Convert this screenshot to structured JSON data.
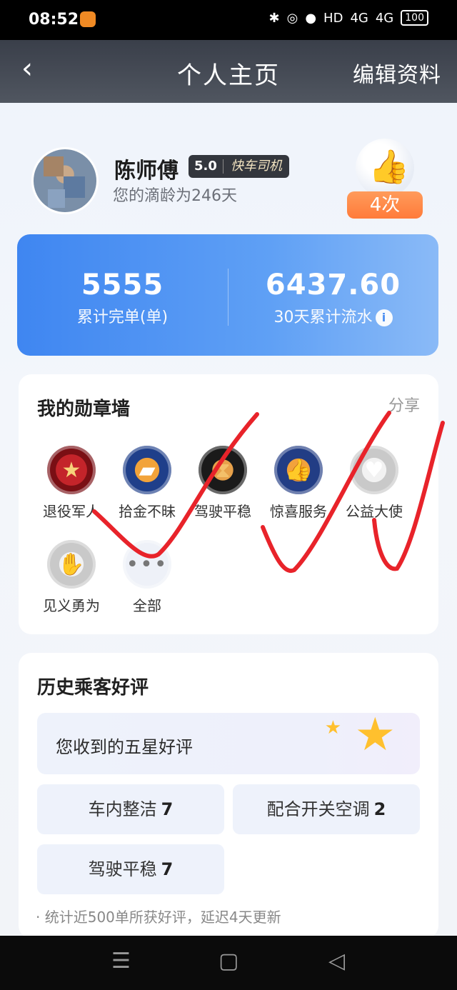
{
  "status_bar": {
    "time": "08:52",
    "network": "4G",
    "network2": "4G",
    "battery": "100",
    "hd": "HD"
  },
  "nav": {
    "back_icon": "chevron-left-icon",
    "title": "个人主页",
    "edit_label": "编辑资料"
  },
  "profile": {
    "name": "陈师傅",
    "rating_score": "5.0",
    "driver_type": "快车司机",
    "age_text": "您的滴龄为246天",
    "likes_label": "4次"
  },
  "stats": {
    "orders": {
      "value": "5555",
      "label": "累计完单(单)"
    },
    "income": {
      "value": "6437.60",
      "label": "30天累计流水"
    }
  },
  "medals": {
    "title": "我的勋章墙",
    "share_label": "分享",
    "items": [
      {
        "label": "退役军人",
        "icon": "star-medal-icon"
      },
      {
        "label": "拾金不昧",
        "icon": "card-medal-icon"
      },
      {
        "label": "驾驶平稳",
        "icon": "hourglass-medal-icon"
      },
      {
        "label": "惊喜服务",
        "icon": "thumbs-up-medal-icon"
      },
      {
        "label": "公益大使",
        "icon": "heart-medal-icon"
      },
      {
        "label": "见义勇为",
        "icon": "hand-medal-icon"
      },
      {
        "label": "全部",
        "icon": "more-icon"
      }
    ]
  },
  "reviews": {
    "title": "历史乘客好评",
    "five_star_label": "您收到的五星好评",
    "tags": [
      {
        "label": "车内整洁",
        "count": "7"
      },
      {
        "label": "配合开关空调",
        "count": "2"
      },
      {
        "label": "驾驶平稳",
        "count": "7"
      }
    ],
    "footnote": "· 统计近500单所获好评，延迟4天更新"
  },
  "colors": {
    "stats_blue": "#3f86f1",
    "likes_orange": "#ff7b3a",
    "scribble_red": "#e8232a"
  }
}
